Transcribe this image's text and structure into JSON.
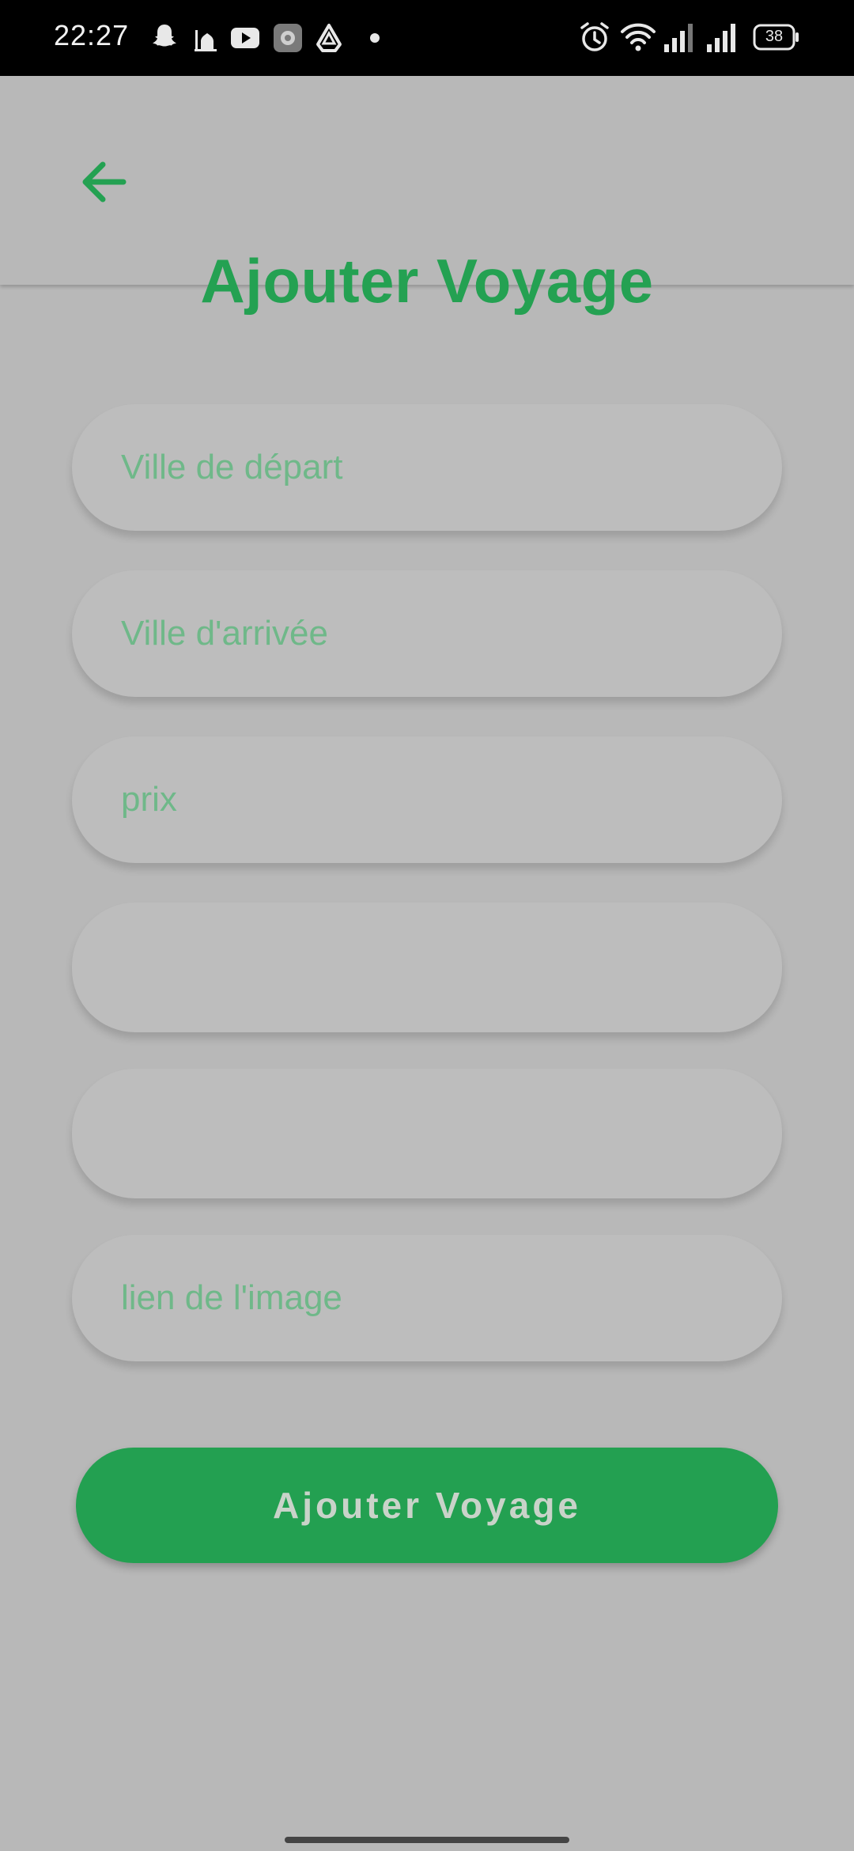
{
  "status_bar": {
    "time": "22:27",
    "battery": "38",
    "left_icons": [
      "snapchat-icon",
      "mosque-icon",
      "youtube-icon",
      "settings-app-icon",
      "drive-icon",
      "dot-icon"
    ],
    "right_icons": [
      "alarm-icon",
      "wifi-icon",
      "signal-icon",
      "signal-icon",
      "battery-icon"
    ]
  },
  "header": {
    "back_icon": "arrow-left-icon",
    "title": "Ajouter Voyage"
  },
  "form": {
    "fields": [
      {
        "placeholder": "Ville de départ",
        "value": ""
      },
      {
        "placeholder": "Ville d'arrivée",
        "value": ""
      },
      {
        "placeholder": "prix",
        "value": ""
      },
      {
        "placeholder": "",
        "value": ""
      },
      {
        "placeholder": "",
        "value": ""
      },
      {
        "placeholder": "lien de l'image",
        "value": ""
      }
    ],
    "submit_label": "Ajouter Voyage"
  },
  "colors": {
    "accent": "#23a051",
    "background": "#b8b8b8",
    "field_background": "#bdbdbd",
    "placeholder": "#6fb889"
  }
}
